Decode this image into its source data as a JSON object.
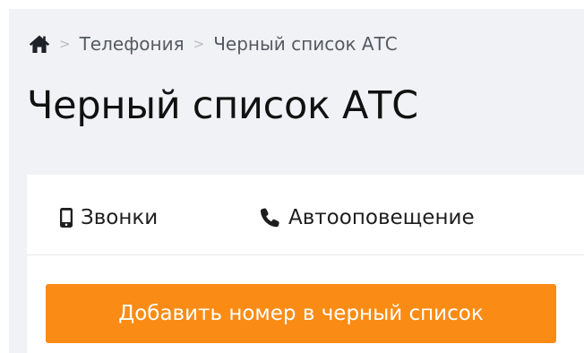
{
  "breadcrumb": {
    "home_icon": "home-icon",
    "separator": ">",
    "items": [
      "Телефония",
      "Черный список АТС"
    ]
  },
  "page": {
    "title": "Черный список АТС"
  },
  "tabs": [
    {
      "label": "Звонки",
      "icon": "mobile-phone-icon"
    },
    {
      "label": "Автооповещение",
      "icon": "phone-handset-icon"
    }
  ],
  "actions": {
    "add_button_label": "Добавить номер в черный список"
  },
  "colors": {
    "accent": "#fa8c16",
    "page_background": "#f1f2f5",
    "card_background": "#ffffff",
    "text_primary": "#111111",
    "breadcrumb_text": "#555a62"
  }
}
